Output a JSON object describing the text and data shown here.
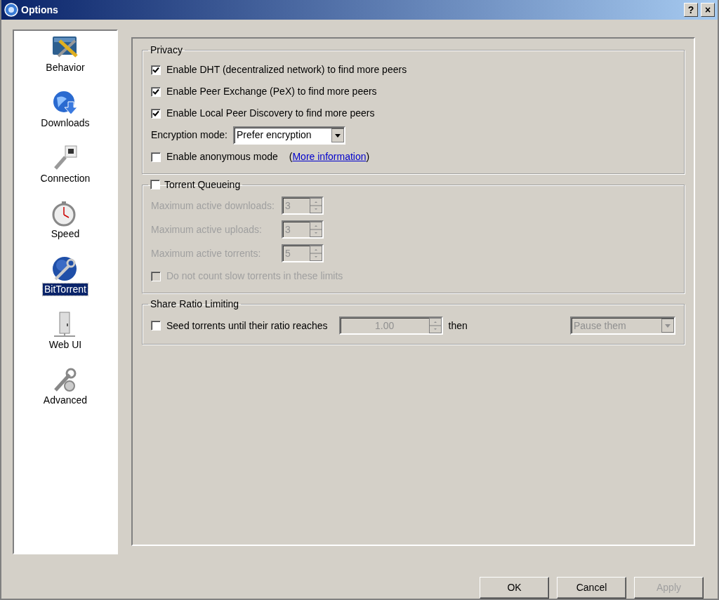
{
  "window": {
    "title": "Options",
    "buttons": [
      "?",
      "×"
    ]
  },
  "sidebar": {
    "items": [
      {
        "label": "Behavior",
        "kind": "behavior",
        "selected": false
      },
      {
        "label": "Downloads",
        "kind": "downloads",
        "selected": false
      },
      {
        "label": "Connection",
        "kind": "connection",
        "selected": false
      },
      {
        "label": "Speed",
        "kind": "speed",
        "selected": false
      },
      {
        "label": "BitTorrent",
        "kind": "bittorrent",
        "selected": true
      },
      {
        "label": "Web UI",
        "kind": "webui",
        "selected": false
      },
      {
        "label": "Advanced",
        "kind": "advanced",
        "selected": false
      }
    ]
  },
  "privacy": {
    "title": "Privacy",
    "options": [
      {
        "label": "Enable DHT (decentralized network) to find more peers",
        "checked": true
      },
      {
        "label": "Enable Peer Exchange (PeX) to find more peers",
        "checked": true
      },
      {
        "label": "Enable Local Peer Discovery to find more peers",
        "checked": true
      }
    ],
    "encryption": {
      "label": "Encryption mode:",
      "value": "Prefer encryption"
    },
    "anonymous": {
      "label": "Enable anonymous mode",
      "checked": false,
      "link_open": "(",
      "link": "More information",
      "link_close": ")"
    }
  },
  "queueing": {
    "title": "Torrent Queueing",
    "checked": false,
    "fields": [
      {
        "label": "Maximum active downloads:",
        "value": "3"
      },
      {
        "label": "Maximum active uploads:",
        "value": "3"
      },
      {
        "label": "Maximum active torrents:",
        "value": "5"
      }
    ],
    "slow": {
      "label": "Do not count slow torrents in these limits",
      "checked": false
    }
  },
  "share_ratio": {
    "title": "Share Ratio Limiting",
    "seed": {
      "label": "Seed torrents until their ratio reaches",
      "checked": false
    },
    "ratio": "1.00",
    "then": "then",
    "action": "Pause them"
  },
  "buttons": [
    {
      "label": "OK",
      "disabled": false
    },
    {
      "label": "Cancel",
      "disabled": false
    },
    {
      "label": "Apply",
      "disabled": true
    }
  ]
}
